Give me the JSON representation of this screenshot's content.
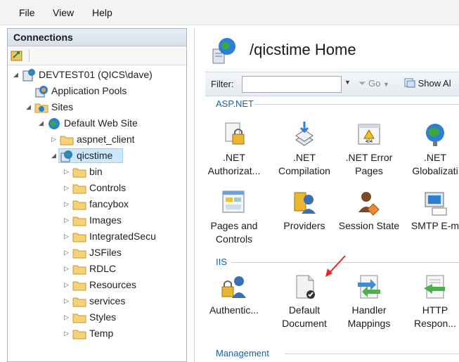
{
  "menu": [
    "File",
    "View",
    "Help"
  ],
  "connections": {
    "header": "Connections",
    "tree": [
      {
        "label": "DEVTEST01 (QICS\\dave)",
        "icon": "server-icon",
        "expander": "◢"
      },
      {
        "label": "Application Pools",
        "icon": "app-pool-icon",
        "expander": ""
      },
      {
        "label": "Sites",
        "icon": "sites-icon",
        "expander": "◢"
      },
      {
        "label": "Default Web Site",
        "icon": "globe-icon",
        "expander": "◢"
      },
      {
        "label": "aspnet_client",
        "icon": "folder-icon",
        "expander": "▷"
      },
      {
        "label": "qicstime",
        "icon": "web-app-icon",
        "expander": "◢",
        "selected": true
      },
      {
        "label": "bin",
        "icon": "folder-icon",
        "expander": "▷"
      },
      {
        "label": "Controls",
        "icon": "folder-icon",
        "expander": "▷"
      },
      {
        "label": "fancybox",
        "icon": "folder-icon",
        "expander": "▷"
      },
      {
        "label": "Images",
        "icon": "folder-icon",
        "expander": "▷"
      },
      {
        "label": "IntegratedSecu",
        "icon": "folder-icon",
        "expander": "▷"
      },
      {
        "label": "JSFiles",
        "icon": "folder-icon",
        "expander": "▷"
      },
      {
        "label": "RDLC",
        "icon": "folder-icon",
        "expander": "▷"
      },
      {
        "label": "Resources",
        "icon": "folder-icon",
        "expander": "▷"
      },
      {
        "label": "services",
        "icon": "folder-icon",
        "expander": "▷"
      },
      {
        "label": "Styles",
        "icon": "folder-icon",
        "expander": "▷"
      },
      {
        "label": "Temp",
        "icon": "folder-icon",
        "expander": "▷"
      }
    ]
  },
  "main": {
    "title": "/qicstime Home",
    "filter": {
      "label": "Filter:",
      "value": "",
      "go": "Go",
      "show_all": "Show Al"
    },
    "sections": [
      {
        "name": "ASP.NET",
        "tiles": [
          {
            "label_lines": [
              ".NET",
              "Authorizat..."
            ],
            "icon": "net-authorization-icon"
          },
          {
            "label_lines": [
              ".NET",
              "Compilation"
            ],
            "icon": "net-compilation-icon"
          },
          {
            "label_lines": [
              ".NET Error",
              "Pages"
            ],
            "icon": "net-error-pages-icon"
          },
          {
            "label_lines": [
              ".NET",
              "Globalizati"
            ],
            "icon": "net-globalization-icon"
          },
          {
            "label_lines": [
              "Pages and",
              "Controls"
            ],
            "icon": "pages-controls-icon"
          },
          {
            "label_lines": [
              "Providers",
              ""
            ],
            "icon": "providers-icon"
          },
          {
            "label_lines": [
              "Session State",
              ""
            ],
            "icon": "session-state-icon"
          },
          {
            "label_lines": [
              "SMTP E-m",
              ""
            ],
            "icon": "smtp-email-icon"
          }
        ]
      },
      {
        "name": "IIS",
        "tiles": [
          {
            "label_lines": [
              "Authentic...",
              ""
            ],
            "icon": "authentication-icon"
          },
          {
            "label_lines": [
              "Default",
              "Document"
            ],
            "icon": "default-document-icon"
          },
          {
            "label_lines": [
              "Handler",
              "Mappings"
            ],
            "icon": "handler-mappings-icon"
          },
          {
            "label_lines": [
              "HTTP",
              "Respon..."
            ],
            "icon": "http-response-icon"
          }
        ]
      },
      {
        "name": "Management",
        "tiles": []
      }
    ]
  },
  "colors": {
    "accent": "#1a5fa8",
    "annotation_arrow": "#e8241a",
    "selection": "#cce8ff"
  }
}
